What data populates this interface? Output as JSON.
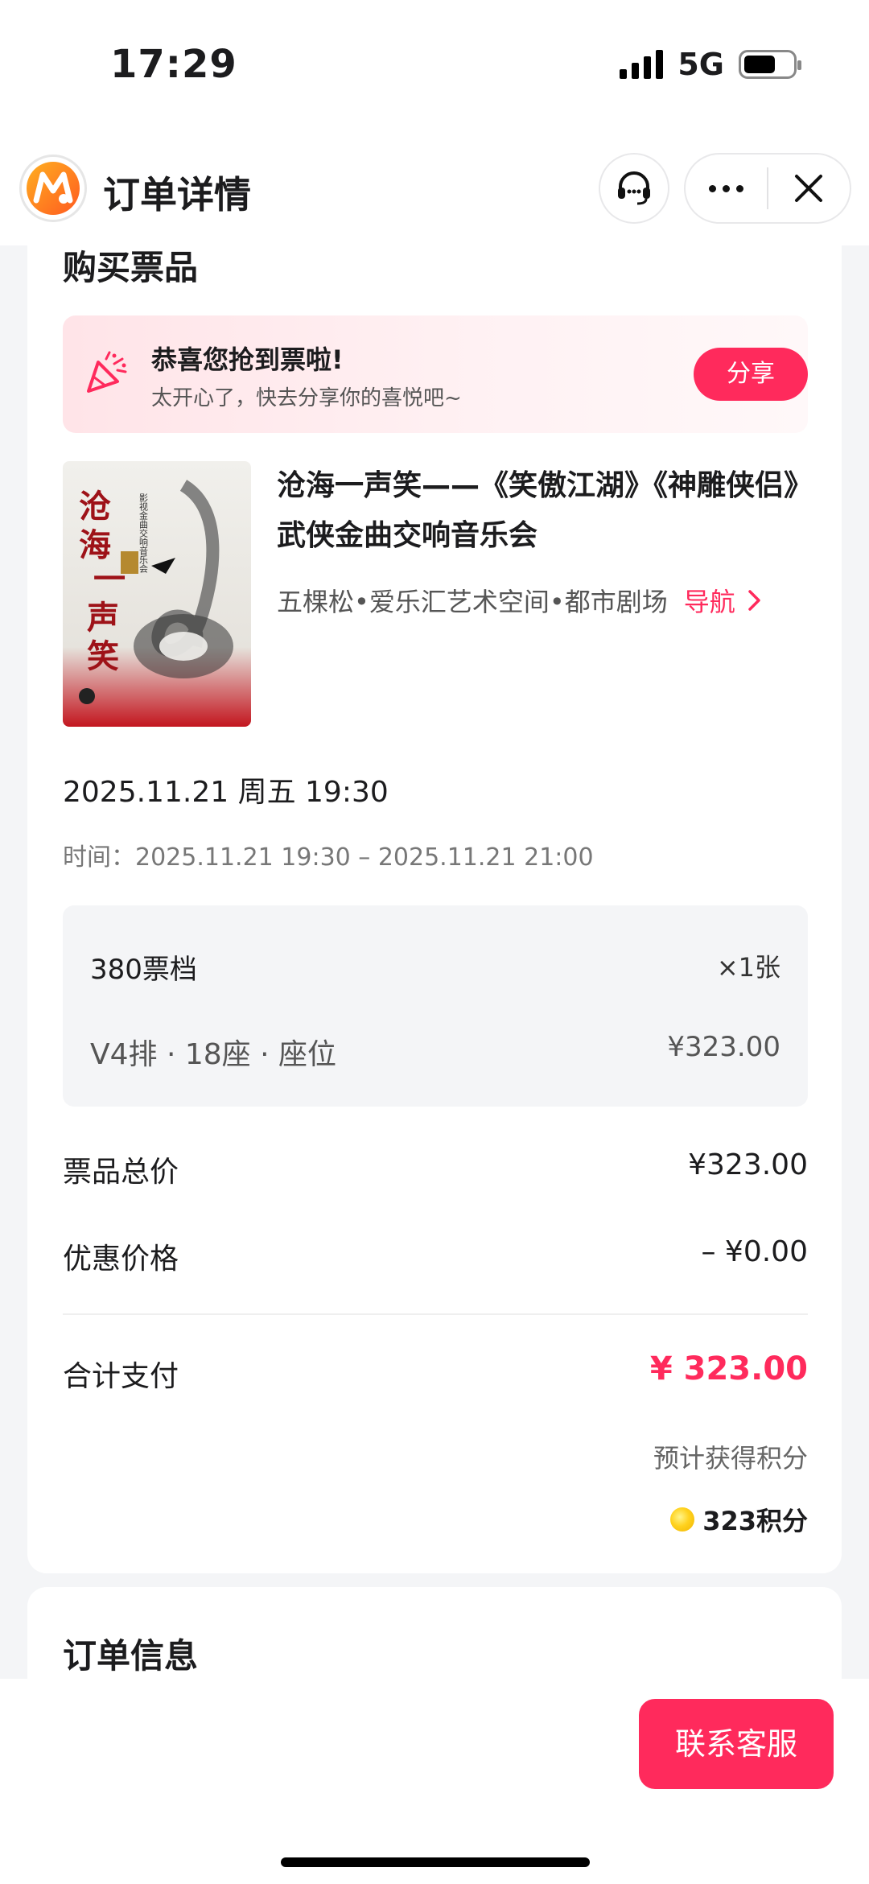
{
  "status_bar": {
    "time": "17:29",
    "network": "5G"
  },
  "nav": {
    "title": "订单详情",
    "icons": [
      "app-logo",
      "headset-icon",
      "more-icon",
      "close-icon"
    ]
  },
  "purchase": {
    "section_title": "购买票品",
    "congrats": {
      "title": "恭喜您抢到票啦!",
      "subtitle": "太开心了，快去分享你的喜悦吧~",
      "share_label": "分享"
    },
    "event": {
      "title": "沧海一声笑——《笑傲江湖》《神雕侠侣》武侠金曲交响音乐会",
      "venue": "五棵松•爱乐汇艺术空间•都市剧场",
      "nav_label": "导航",
      "poster": {
        "title_text": "沧海一声笑",
        "subtitle_text": "影视金曲交响音乐会"
      }
    },
    "date_main": "2025.11.21 周五 19:30",
    "date_range": "时间：2025.11.21 19:30 – 2025.11.21 21:00",
    "ticket": {
      "tier": "380票档",
      "quantity": "×1张",
      "seat": "V4排 · 18座 · 座位",
      "price": "¥323.00"
    },
    "summary": {
      "ticket_total_label": "票品总价",
      "ticket_total_value": "¥323.00",
      "discount_label": "优惠价格",
      "discount_value": "– ¥0.00",
      "pay_label": "合计支付",
      "pay_value": "¥ 323.00",
      "points_label": "预计获得积分",
      "points_value": "323积分"
    }
  },
  "order_info": {
    "section_title": "订单信息"
  },
  "bottom": {
    "contact_label": "联系客服"
  },
  "colors": {
    "accent": "#ff2a5c",
    "background": "#f4f5f7"
  }
}
